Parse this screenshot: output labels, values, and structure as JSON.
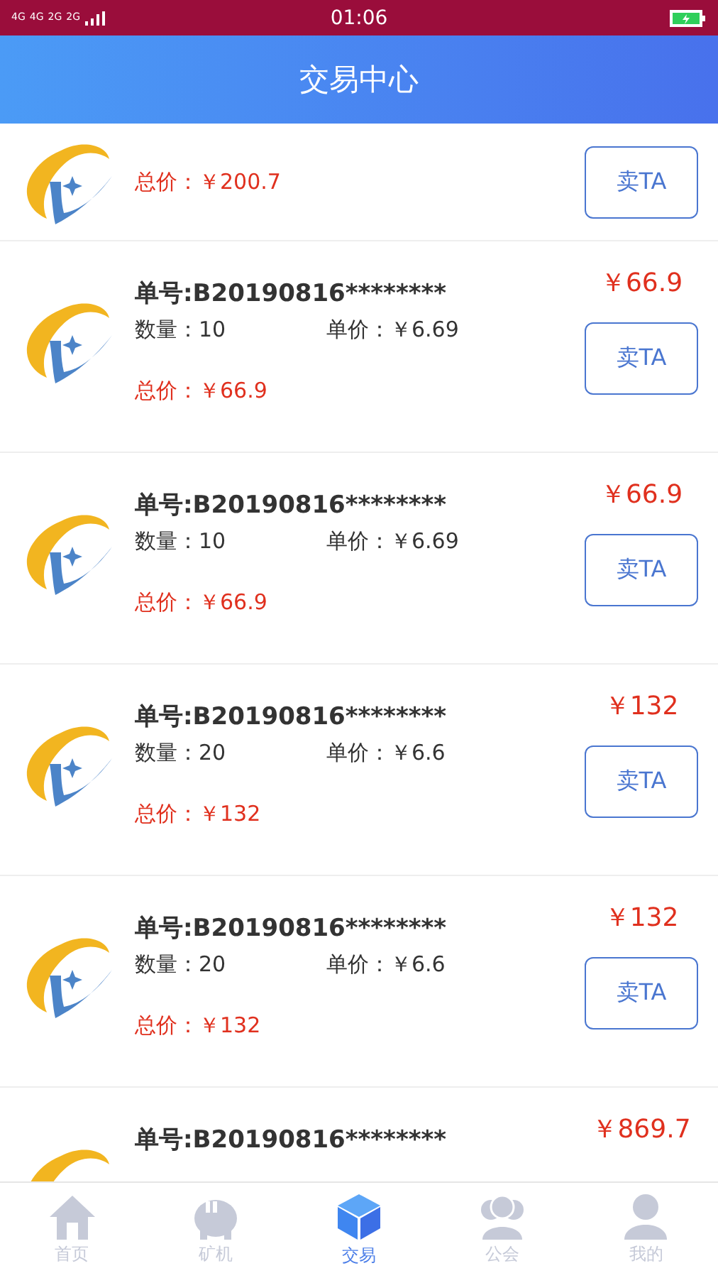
{
  "status_bar": {
    "network": [
      "4G",
      "4G",
      "2G",
      "2G"
    ],
    "time": "01:06"
  },
  "header": {
    "title": "交易中心"
  },
  "orders": [
    {
      "total_label": "总价：",
      "total": "￥200.7",
      "button": "卖TA"
    },
    {
      "order_no": "单号:B20190816********",
      "qty_label": "数量：",
      "qty": "10",
      "unit_label": "单价：",
      "unit": "￥6.69",
      "total_label": "总价：",
      "total": "￥66.9",
      "price": "￥66.9",
      "button": "卖TA"
    },
    {
      "order_no": "单号:B20190816********",
      "qty_label": "数量：",
      "qty": "10",
      "unit_label": "单价：",
      "unit": "￥6.69",
      "total_label": "总价：",
      "total": "￥66.9",
      "price": "￥66.9",
      "button": "卖TA"
    },
    {
      "order_no": "单号:B20190816********",
      "qty_label": "数量：",
      "qty": "20",
      "unit_label": "单价：",
      "unit": "￥6.6",
      "total_label": "总价：",
      "total": "￥132",
      "price": "￥132",
      "button": "卖TA"
    },
    {
      "order_no": "单号:B20190816********",
      "qty_label": "数量：",
      "qty": "20",
      "unit_label": "单价：",
      "unit": "￥6.6",
      "total_label": "总价：",
      "total": "￥132",
      "price": "￥132",
      "button": "卖TA"
    },
    {
      "order_no": "单号:B20190816********",
      "price": "￥869.7"
    }
  ],
  "tabs": [
    {
      "kind": "home",
      "label": "首页",
      "selected": false
    },
    {
      "kind": "miner",
      "label": "矿机",
      "selected": false
    },
    {
      "kind": "trade",
      "label": "交易",
      "selected": true
    },
    {
      "kind": "guild",
      "label": "公会",
      "selected": false
    },
    {
      "kind": "mine",
      "label": "我的",
      "selected": false
    }
  ]
}
